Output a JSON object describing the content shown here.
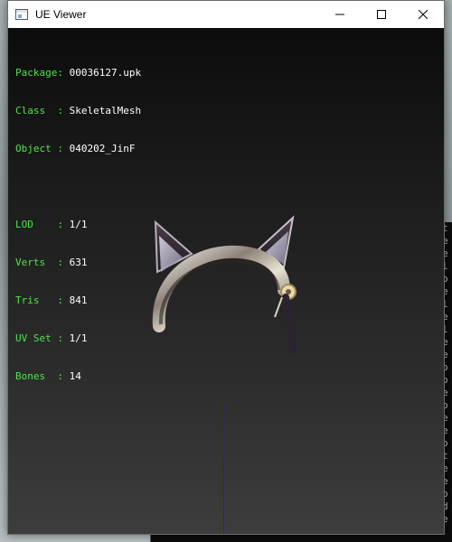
{
  "window": {
    "title": "UE Viewer"
  },
  "info": {
    "rows": [
      {
        "key": "Package: ",
        "value": "00036127.upk"
      },
      {
        "key": "Class  : ",
        "value": "SkeletalMesh"
      },
      {
        "key": "Object : ",
        "value": "040202_JinF"
      },
      {
        "key": "LOD    : ",
        "value": "1/1"
      },
      {
        "key": "Verts  : ",
        "value": "631"
      },
      {
        "key": "Tris   : ",
        "value": "841"
      },
      {
        "key": "UV Set : ",
        "value": "1/1"
      },
      {
        "key": "Bones  : ",
        "value": "14"
      }
    ]
  },
  "console": {
    "side_chars": [
      "t",
      "e",
      "e",
      "l",
      "o",
      "e",
      "l",
      "e",
      "l",
      "e",
      "e",
      "o",
      "o",
      "e",
      "o",
      "e",
      "e",
      "o",
      "t",
      "e",
      "e",
      "o",
      "d",
      "e",
      "e"
    ],
    "bottom_line": "[Dstotli] process  \"Alrema win setsize\" on"
  },
  "icons": {
    "app": "app-window-icon",
    "minimize": "minimize-icon",
    "maximize": "maximize-icon",
    "close": "close-icon"
  },
  "colors": {
    "label": "#4ee44e",
    "value": "#ffffff",
    "axis": "#1e1ec8",
    "viewport_bg": "#1b1b1b"
  }
}
